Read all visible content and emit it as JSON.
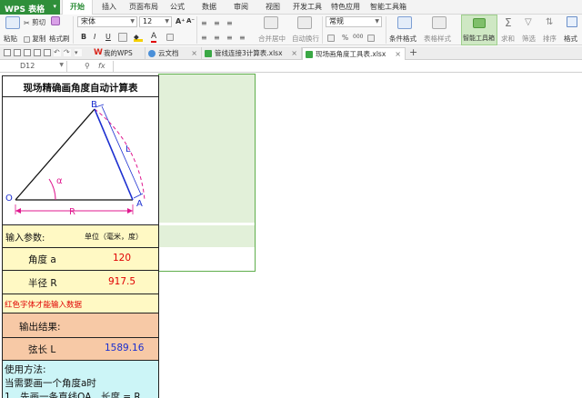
{
  "app": {
    "name": "WPS 表格",
    "menu_arrow": "▾"
  },
  "ribbon_tabs": [
    {
      "label": "开始",
      "active": true
    },
    {
      "label": "插入"
    },
    {
      "label": "页面布局"
    },
    {
      "label": "公式"
    },
    {
      "label": "数据"
    },
    {
      "label": "审阅"
    },
    {
      "label": "视图"
    },
    {
      "label": "开发工具"
    },
    {
      "label": "特色应用"
    },
    {
      "label": "智能工具箱"
    }
  ],
  "toolbar": {
    "paste": "粘贴",
    "cut": "剪切",
    "copy": "复制",
    "format_painter": "格式刷",
    "font_name": "宋体",
    "font_size": "12",
    "bold": "B",
    "italic": "I",
    "underline": "U",
    "grow_font": "A⁺",
    "shrink_font": "A⁻",
    "number_format": "常规",
    "percent": "%",
    "thousands": "000",
    "merge_center": "合并居中",
    "wrap_text": "自动换行",
    "conditional_format": "条件格式",
    "table_style": "表格样式",
    "smart_toolbox": "智能工具箱",
    "sum": "求和",
    "filter": "筛选",
    "sort": "排序",
    "format": "格式"
  },
  "doc_tabs": [
    {
      "label": "我的WPS"
    },
    {
      "label": "云文档"
    },
    {
      "label": "管线连接3计算表.xlsx"
    },
    {
      "label": "现场画角度工具表.xlsx",
      "active": true
    }
  ],
  "formula_bar": {
    "cell_ref": "D12",
    "fx": "fx",
    "content": ""
  },
  "sheet": {
    "title": "现场精确画角度自动计算表",
    "diagram_labels": {
      "B": "B",
      "L": "L",
      "O": "O",
      "alpha": "α",
      "A": "A",
      "R": "R"
    },
    "input_header": "输入参数:",
    "units": "单位（毫米，度）",
    "angle_label": "角度 a",
    "angle_value": "120",
    "radius_label": "半径 R",
    "radius_value": "917.5",
    "red_note": "红色字体才能输入数据",
    "output_header": "输出结果:",
    "chord_label": "弦长 L",
    "chord_value": "1589.16",
    "usage_title": "使用方法:",
    "usage_line1": "当需要画一个角度a时",
    "usage_line2": "1、先画一条直线OA，长度 = R"
  },
  "colors": {
    "wps_green": "#2f8f3a",
    "input_yellow": "#fff9c4",
    "output_orange": "#f7c9a6",
    "usage_cyan": "#ccf5f7",
    "selection_green": "#e2f0d9",
    "red_text": "#e00000",
    "blue_text": "#1a2fd0",
    "diagram_blue": "#1c2fd0",
    "diagram_magenta": "#e0198f"
  }
}
